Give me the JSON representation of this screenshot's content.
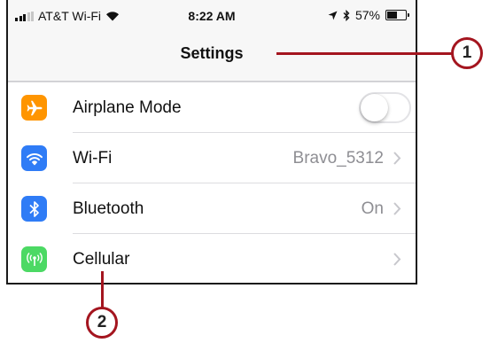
{
  "status_bar": {
    "carrier": "AT&T Wi-Fi",
    "time": "8:22 AM",
    "battery_percent": "57%",
    "battery_level": 0.57,
    "icons": [
      "signal-bars-icon",
      "wifi-icon",
      "location-arrow-icon",
      "bluetooth-icon",
      "battery-icon"
    ]
  },
  "nav": {
    "title": "Settings"
  },
  "settings": {
    "items": [
      {
        "label": "Airplane Mode",
        "icon": "airplane-icon",
        "color": "#ff9500",
        "toggle_on": false
      },
      {
        "label": "Wi-Fi",
        "icon": "wifi-icon",
        "color": "#2f7cf6",
        "value": "Bravo_5312"
      },
      {
        "label": "Bluetooth",
        "icon": "bluetooth-icon",
        "color": "#2f7cf6",
        "value": "On"
      },
      {
        "label": "Cellular",
        "icon": "cellular-antenna-icon",
        "color": "#4cd964",
        "value": ""
      }
    ]
  },
  "callouts": {
    "one": "1",
    "two": "2",
    "color": "#a4151f"
  }
}
